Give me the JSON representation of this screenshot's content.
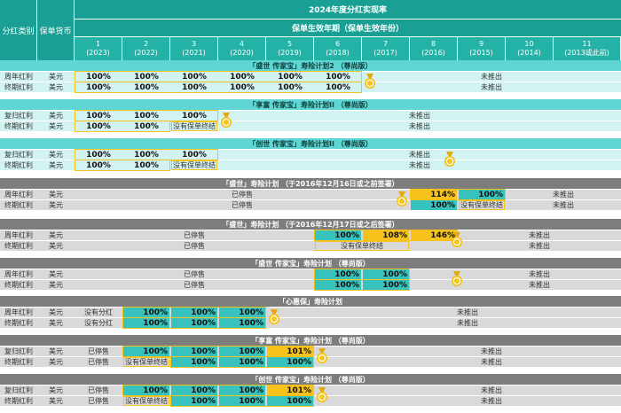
{
  "header": {
    "title": "2024年度分红实现率",
    "subtitle": "保单生效年期（保单生效年份）",
    "col_category": "分红类别",
    "col_currency": "保单货币",
    "years": [
      {
        "num": "1",
        "year": "(2023)"
      },
      {
        "num": "2",
        "year": "(2022)"
      },
      {
        "num": "3",
        "year": "(2021)"
      },
      {
        "num": "4",
        "year": "(2020)"
      },
      {
        "num": "5",
        "year": "(2019)"
      },
      {
        "num": "6",
        "year": "(2018)"
      },
      {
        "num": "7",
        "year": "(2017)"
      },
      {
        "num": "8",
        "year": "(2016)"
      },
      {
        "num": "9",
        "year": "(2015)"
      },
      {
        "num": "10",
        "year": "(2014)"
      },
      {
        "num": "11",
        "year": "(2013或此前)"
      }
    ]
  },
  "colors": {
    "teal_dark": "#1a9f94",
    "teal_light": "#24b2a7",
    "section_light": "#5fd6d3",
    "row_light": "#d3f2f2",
    "section_grey": "#7d7d7d",
    "row_grey": "#d9d9d9",
    "cell_teal": "#37c2bd",
    "cell_gold": "#f7c21b",
    "medal": "#f4c316"
  },
  "sections": [
    {
      "title": "「盛世 传家宝」寿险计划2 （尊尚版）",
      "rows": [
        {
          "cat": "周年红利",
          "cur": "美元",
          "cells": [
            "100%",
            "100%",
            "100%",
            "100%",
            "100%",
            "100%"
          ],
          "tail": "未推出"
        },
        {
          "cat": "终期红利",
          "cur": "美元",
          "cells": [
            "100%",
            "100%",
            "100%",
            "100%",
            "100%",
            "100%"
          ],
          "tail": "未推出"
        }
      ]
    },
    {
      "title": "「享富 传家宝」寿险计划II （尊尚版）",
      "rows": [
        {
          "cat": "复归红利",
          "cur": "美元",
          "cells": [
            "100%",
            "100%",
            "100%"
          ],
          "tail": "未推出"
        },
        {
          "cat": "终期红利",
          "cur": "美元",
          "cells": [
            "100%",
            "100%",
            "没有保单终结"
          ],
          "tail": "未推出"
        }
      ]
    },
    {
      "title": "「创世 传家宝」寿险计划II （尊尚版）",
      "rows": [
        {
          "cat": "复归红利",
          "cur": "美元",
          "cells": [
            "100%",
            "100%",
            "100%"
          ],
          "tail": "未推出"
        },
        {
          "cat": "终期红利",
          "cur": "美元",
          "cells": [
            "100%",
            "100%",
            "没有保单终结"
          ],
          "tail": "未推出"
        }
      ]
    },
    {
      "title": "「盛世」寿险计划 （于2016年12月16日或之前签署）",
      "rows": [
        {
          "cat": "周年红利",
          "cur": "美元",
          "pre": "已停售",
          "cells": [
            "114%",
            "100%"
          ],
          "tail": "未推出"
        },
        {
          "cat": "终期红利",
          "cur": "美元",
          "pre": "已停售",
          "cells": [
            "100%",
            "没有保单终结"
          ],
          "tail": "未推出"
        }
      ]
    },
    {
      "title": "「盛世」寿险计划 （于2016年12月17日或之后签署）",
      "rows": [
        {
          "cat": "周年红利",
          "cur": "美元",
          "pre": "已停售",
          "cells": [
            "100%",
            "108%",
            "146%"
          ],
          "tail": "未推出"
        },
        {
          "cat": "终期红利",
          "cur": "美元",
          "pre": "已停售",
          "cells": [
            "没有保单终结"
          ],
          "tail": "未推出"
        }
      ]
    },
    {
      "title": "「盛世 传家宝」寿险计划 （尊尚版）",
      "rows": [
        {
          "cat": "周年红利",
          "cur": "美元",
          "pre": "已停售",
          "cells": [
            "100%",
            "100%"
          ],
          "tail": "未推出"
        },
        {
          "cat": "终期红利",
          "cur": "美元",
          "pre": "已停售",
          "cells": [
            "100%",
            "100%"
          ],
          "tail": "未推出"
        }
      ]
    },
    {
      "title": "「心惠保」寿险计划",
      "rows": [
        {
          "cat": "周年红利",
          "cur": "美元",
          "pre": "没有分红",
          "cells": [
            "100%",
            "100%",
            "100%"
          ],
          "tail": "未推出"
        },
        {
          "cat": "终期红利",
          "cur": "美元",
          "pre": "没有分红",
          "cells": [
            "100%",
            "100%",
            "100%"
          ],
          "tail": "未推出"
        }
      ]
    },
    {
      "title": "「享富 传家宝」寿险计划 （尊尚版）",
      "rows": [
        {
          "cat": "复归红利",
          "cur": "美元",
          "pre": "已停售",
          "cells": [
            "100%",
            "100%",
            "100%",
            "101%"
          ],
          "tail": "未推出"
        },
        {
          "cat": "终期红利",
          "cur": "美元",
          "pre": "已停售",
          "cells": [
            "没有保单终结",
            "100%",
            "100%",
            "100%"
          ],
          "tail": "未推出"
        }
      ]
    },
    {
      "title": "「创世 传家宝」寿险计划 （尊尚版）",
      "rows": [
        {
          "cat": "复归红利",
          "cur": "美元",
          "pre": "已停售",
          "cells": [
            "100%",
            "100%",
            "100%",
            "101%"
          ],
          "tail": "未推出"
        },
        {
          "cat": "终期红利",
          "cur": "美元",
          "pre": "已停售",
          "cells": [
            "没有保单终结",
            "100%",
            "100%",
            "100%"
          ],
          "tail": "未推出"
        }
      ]
    }
  ]
}
